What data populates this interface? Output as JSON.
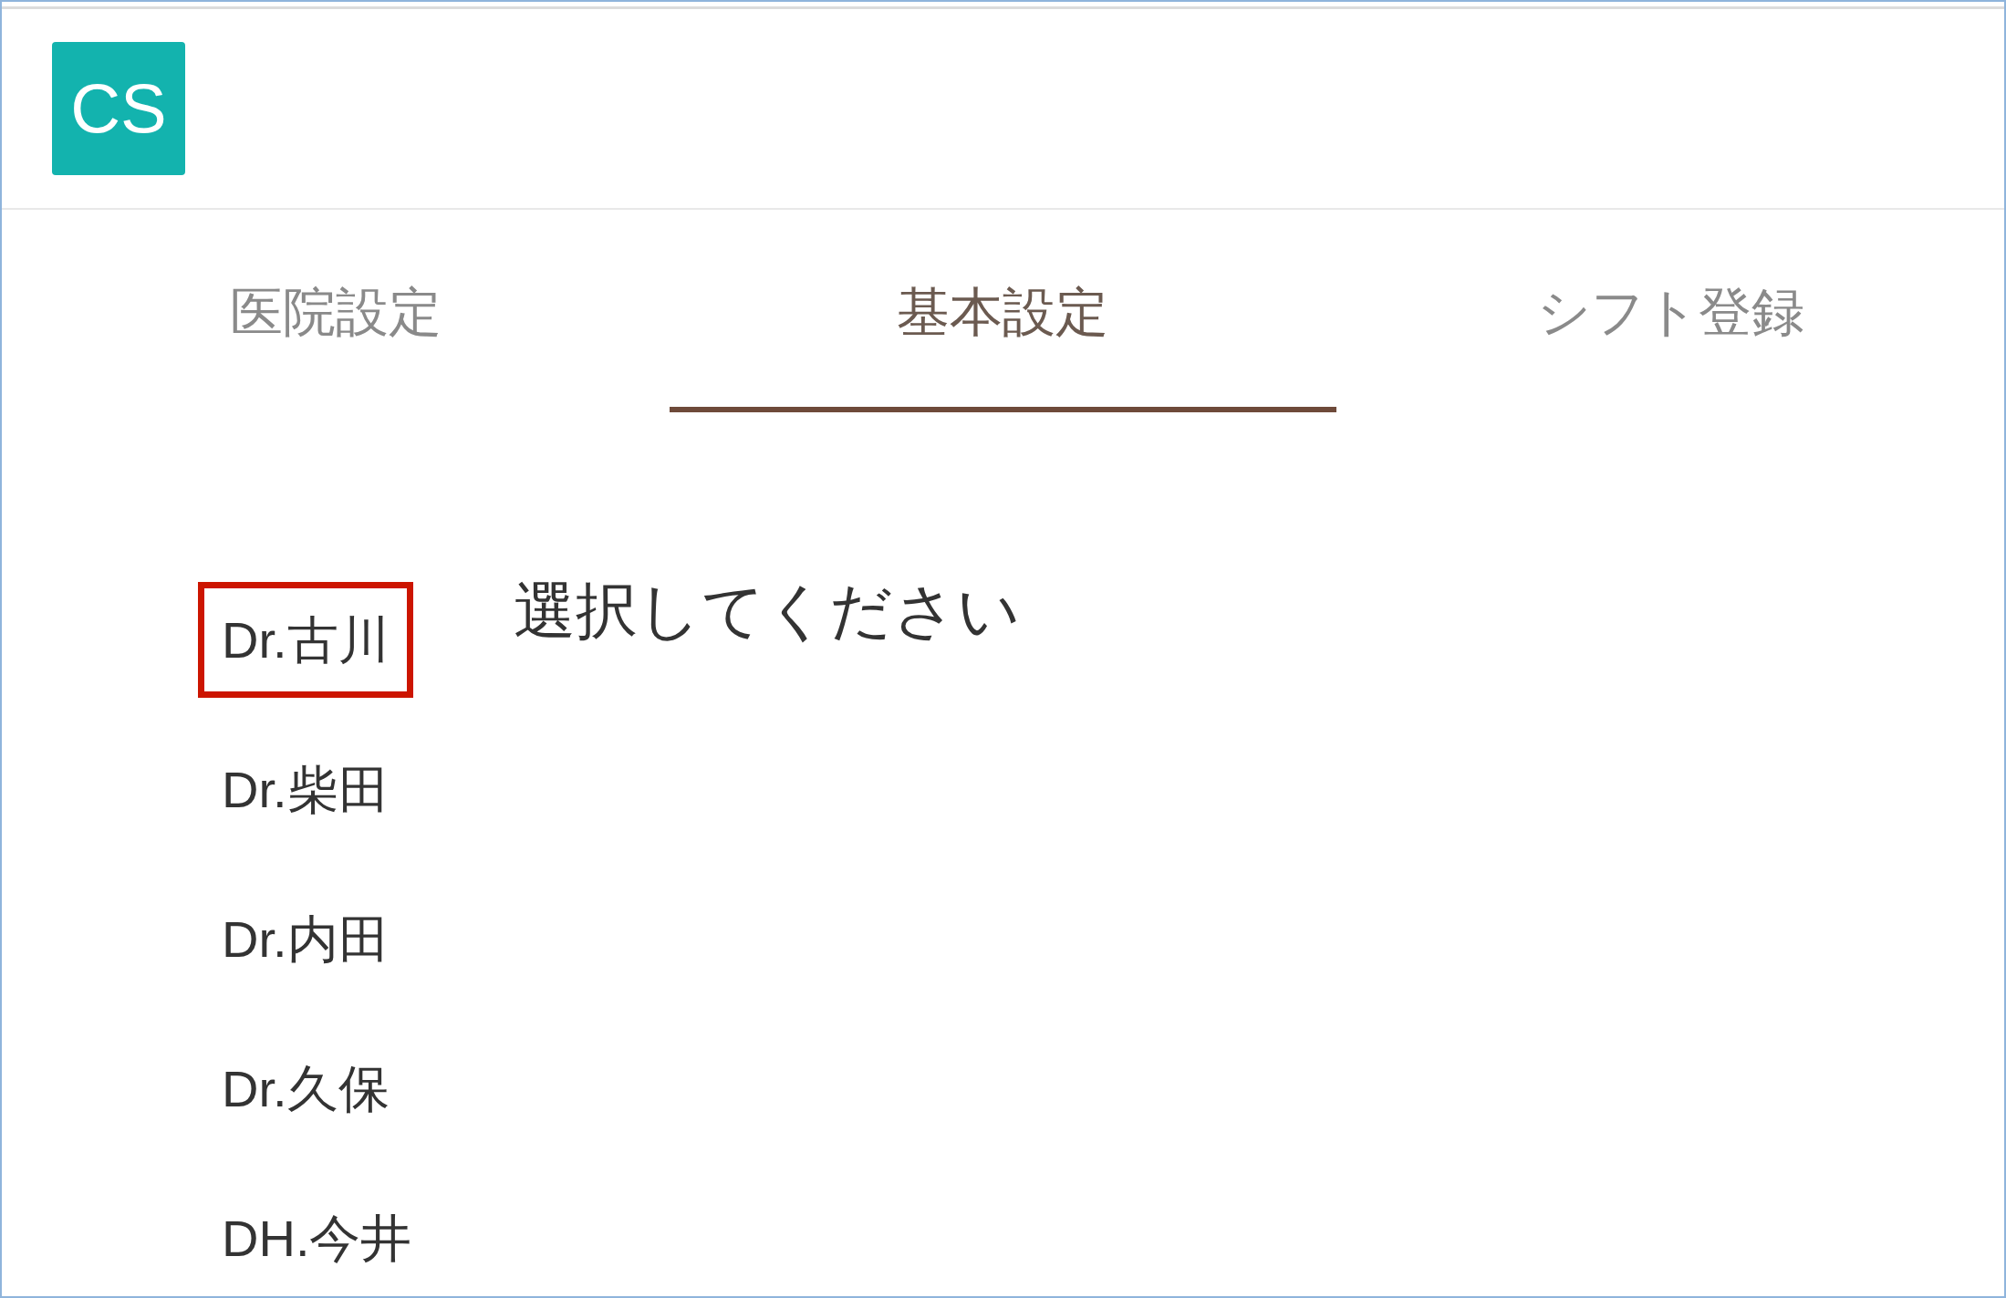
{
  "logo": {
    "text": "CS"
  },
  "tabs": [
    {
      "label": "医院設定",
      "selected": false
    },
    {
      "label": "基本設定",
      "selected": true
    },
    {
      "label": "シフト登録",
      "selected": false
    }
  ],
  "staff": [
    {
      "name": "Dr.古川",
      "highlighted": true
    },
    {
      "name": "Dr.柴田",
      "highlighted": false
    },
    {
      "name": "Dr.内田",
      "highlighted": false
    },
    {
      "name": "Dr.久保",
      "highlighted": false
    },
    {
      "name": "DH.今井",
      "highlighted": false
    }
  ],
  "message": "選択してください"
}
